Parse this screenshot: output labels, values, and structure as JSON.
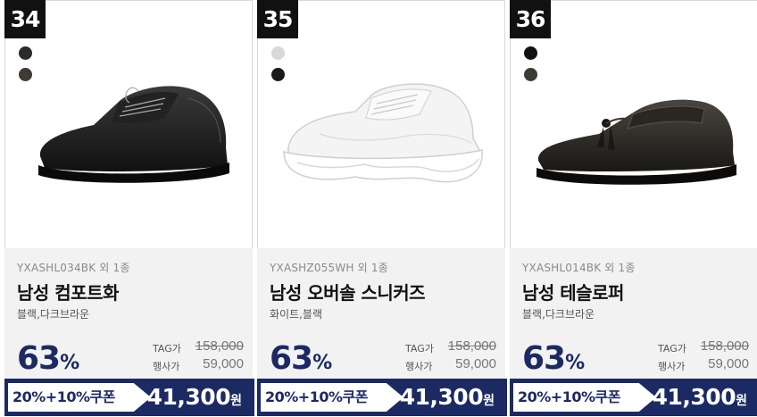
{
  "products": [
    {
      "rank": "34",
      "swatches": [
        "#2b2b2b",
        "#3e3a34"
      ],
      "code": "YXASHL034BK 외 1종",
      "name": "남성 컴포트화",
      "colors": "블랙,다크브라운",
      "discount": "63",
      "discount_unit": "%",
      "tag_label": "TAG가",
      "tag_price": "158,000",
      "sale_label": "행사가",
      "sale_price": "59,000",
      "coupon": "20%+10%쿠폰",
      "final_price": "41,300",
      "currency": "원",
      "image_icon": "black-derby-shoe-icon"
    },
    {
      "rank": "35",
      "swatches": [
        "#d8d8d8",
        "#1a1a1a"
      ],
      "code": "YXASHZ055WH 외 1종",
      "name": "남성 오버솔 스니커즈",
      "colors": "화이트,블랙",
      "discount": "63",
      "discount_unit": "%",
      "tag_label": "TAG가",
      "tag_price": "158,000",
      "sale_label": "행사가",
      "sale_price": "59,000",
      "coupon": "20%+10%쿠폰",
      "final_price": "41,300",
      "currency": "원",
      "image_icon": "white-chunky-sneaker-icon"
    },
    {
      "rank": "36",
      "swatches": [
        "#111111",
        "#3e3a34"
      ],
      "code": "YXASHL014BK 외 1종",
      "name": "남성 테슬로퍼",
      "colors": "블랙,다크브라운",
      "discount": "63",
      "discount_unit": "%",
      "tag_label": "TAG가",
      "tag_price": "158,000",
      "sale_label": "행사가",
      "sale_price": "59,000",
      "coupon": "20%+10%쿠폰",
      "final_price": "41,300",
      "currency": "원",
      "image_icon": "tassel-loafer-icon"
    }
  ],
  "colors": {
    "accent_navy": "#1c2a63",
    "rank_badge": "#111111",
    "info_bg": "#f2f2f2"
  }
}
